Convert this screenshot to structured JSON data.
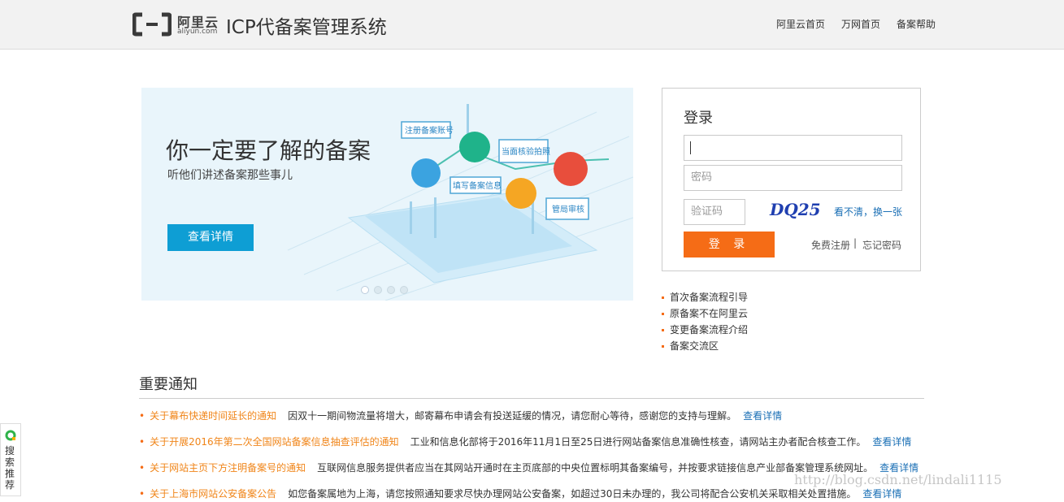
{
  "header": {
    "logo_cn": "阿里云",
    "logo_en": "aliyun.com",
    "title": "ICP代备案管理系统",
    "nav": [
      "阿里云首页",
      "万网首页",
      "备案帮助"
    ]
  },
  "banner": {
    "title": "你一定要了解的备案",
    "subtitle": "听他们讲述备案那些事儿",
    "button": "查看详情",
    "tags": [
      "注册备案账号",
      "当面核验拍照",
      "填写备案信息",
      "管局审核"
    ],
    "slides_count": 4,
    "active_slide": 1
  },
  "login": {
    "title": "登录",
    "username_placeholder": "",
    "password_placeholder": "密码",
    "captcha_placeholder": "验证码",
    "captcha_text": "DQ25",
    "refresh_link": "看不清，换一张",
    "submit": "登 录",
    "register": "免费注册",
    "separator": "|",
    "forgot": "忘记密码"
  },
  "quick_links": [
    "首次备案流程引导",
    "原备案不在阿里云",
    "变更备案流程介绍",
    "备案交流区"
  ],
  "notices": {
    "title": "重要通知",
    "items": [
      {
        "title": "关于幕布快递时间延长的通知",
        "text": "因双十一期间物流量将增大，邮寄幕布申请会有投送延缓的情况，请您耐心等待，感谢您的支持与理解。",
        "more": "查看详情"
      },
      {
        "title": "关于开展2016年第二次全国网站备案信息抽查评估的通知",
        "text": "工业和信息化部将于2016年11月1日至25日进行网站备案信息准确性核查，请网站主办者配合核查工作。",
        "more": "查看详情"
      },
      {
        "title": "关于网站主页下方注明备案号的通知",
        "text": "互联网信息服务提供者应当在其网站开通时在主页底部的中央位置标明其备案编号，并按要求链接信息产业部备案管理系统网址。",
        "more": "查看详情"
      },
      {
        "title": "关于上海市网站公安备案公告",
        "text": "如您备案属地为上海，请您按照通知要求尽快办理网站公安备案，如超过30日未办理的，我公司将配合公安机关采取相关处置措施。",
        "more": "查看详情"
      }
    ]
  },
  "side_widget": {
    "label": "搜索推荐"
  },
  "watermark": "http://blog.csdn.net/lindali1115",
  "colors": {
    "accent": "#f56c16",
    "banner_button": "#0e9ed4",
    "link": "#1a6fb5",
    "notice_title": "#f08519"
  }
}
